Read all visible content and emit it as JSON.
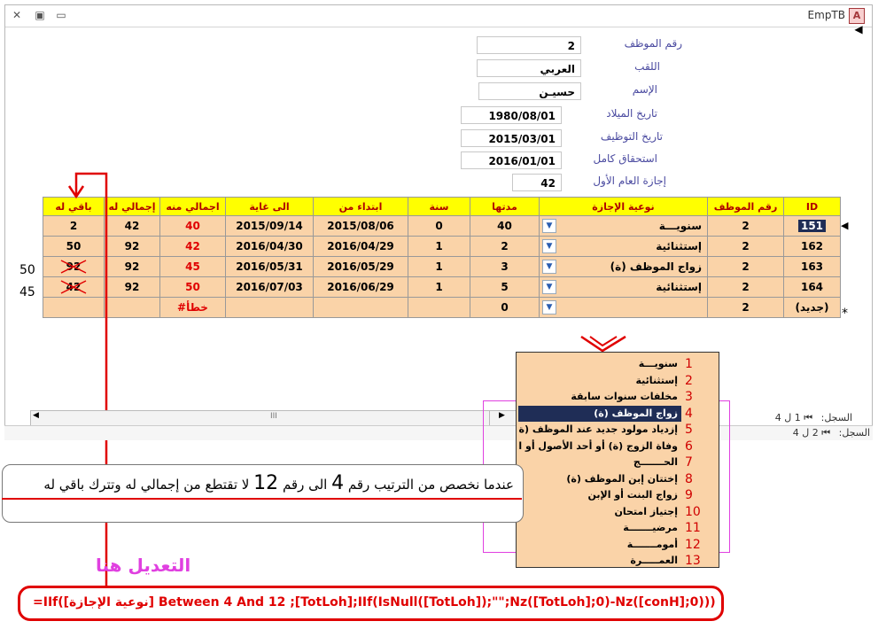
{
  "window": {
    "title": "EmpTB",
    "app_icon_letter": "A"
  },
  "form": {
    "fields": [
      {
        "label": "رقم الموظف",
        "value": "2"
      },
      {
        "label": "اللقب",
        "value": "العربي"
      },
      {
        "label": "الإسم",
        "value": "حسيـن"
      },
      {
        "label": "تاريخ الميلاد",
        "value": "1980/08/01"
      },
      {
        "label": "تاريخ التوظيف",
        "value": "2015/03/01"
      },
      {
        "label": "استحقاق كامل",
        "value": "2016/01/01"
      },
      {
        "label": "إجازة العام الأول",
        "value": "42"
      }
    ]
  },
  "grid": {
    "headers": [
      "باقي له",
      "إجمالي له",
      "اجمالي منه",
      "الى غاية",
      "ابتداء من",
      "سنة",
      "مدتها",
      "نوعية الإجازة",
      "رقم الموظف",
      "ID"
    ],
    "rows": [
      [
        "2",
        "42",
        "40",
        "2015/09/14",
        "2015/08/06",
        "0",
        "40",
        "سنويـــة",
        "2",
        "151"
      ],
      [
        "50",
        "92",
        "42",
        "2016/04/30",
        "2016/04/29",
        "1",
        "2",
        "إستثنائية",
        "2",
        "162"
      ],
      [
        "92",
        "92",
        "45",
        "2016/05/31",
        "2016/05/29",
        "1",
        "3",
        "زواج الموظف (ة)",
        "2",
        "163"
      ],
      [
        "42",
        "92",
        "50",
        "2016/07/03",
        "2016/06/29",
        "1",
        "5",
        "إستثنائية",
        "2",
        "164"
      ],
      [
        "",
        "",
        "#خطأ",
        "",
        "",
        "",
        "0",
        "",
        "2",
        "(جديد)"
      ]
    ],
    "new_row_marker": "*"
  },
  "side_notes": [
    "50",
    "45"
  ],
  "navigation": {
    "record_label": "السجل:",
    "record_value_1": "1 ل 4",
    "record_value_2": "2 ل 4",
    "hscroll_thumb": "III"
  },
  "dropdown": {
    "options": [
      {
        "num": "1",
        "label": "سنويـــة"
      },
      {
        "num": "2",
        "label": "إستثنائية"
      },
      {
        "num": "3",
        "label": "مخلفات سنوات سابقة"
      },
      {
        "num": "4",
        "label": "زواج الموظف (ة)"
      },
      {
        "num": "5",
        "label": "إزدياد مولود جديد عند الموظف (ة)"
      },
      {
        "num": "6",
        "label": "وفاة الزوج (ة) أو أحد الأصول أو الف"
      },
      {
        "num": "7",
        "label": "الحـــــــج"
      },
      {
        "num": "8",
        "label": "إختتان إبن الموظف (ة)"
      },
      {
        "num": "9",
        "label": "زواج البنت أو الإبن"
      },
      {
        "num": "10",
        "label": "إجتياز امتحان"
      },
      {
        "num": "11",
        "label": "مرضيـــــــة"
      },
      {
        "num": "12",
        "label": "أمومـــــــة"
      },
      {
        "num": "13",
        "label": "العمـــــرة"
      }
    ],
    "selected_index": 3
  },
  "annotations": {
    "note_part1": "عندما نخصص من الترتيب رقم",
    "note_num1": "4",
    "note_part2": "الى رقم",
    "note_num2": "12",
    "note_part3": "لا تقتطع من إجمالي له وتترك باقي له",
    "edit_here": "التعديل هنا",
    "formula": "=IIf([نوعية الإجازة] Between 4 And 12 ;[TotLoh];IIf(IsNull([TotLoh]);\"\";Nz([TotLoh];0)-Nz([conH];0)))"
  },
  "colors": {
    "header_bg": "#ffff00",
    "header_text": "#b00000",
    "row_bg": "#fad3a8",
    "selection": "#1f2d56",
    "annotation_red": "#e00000",
    "annotation_pink": "#e040e0"
  }
}
